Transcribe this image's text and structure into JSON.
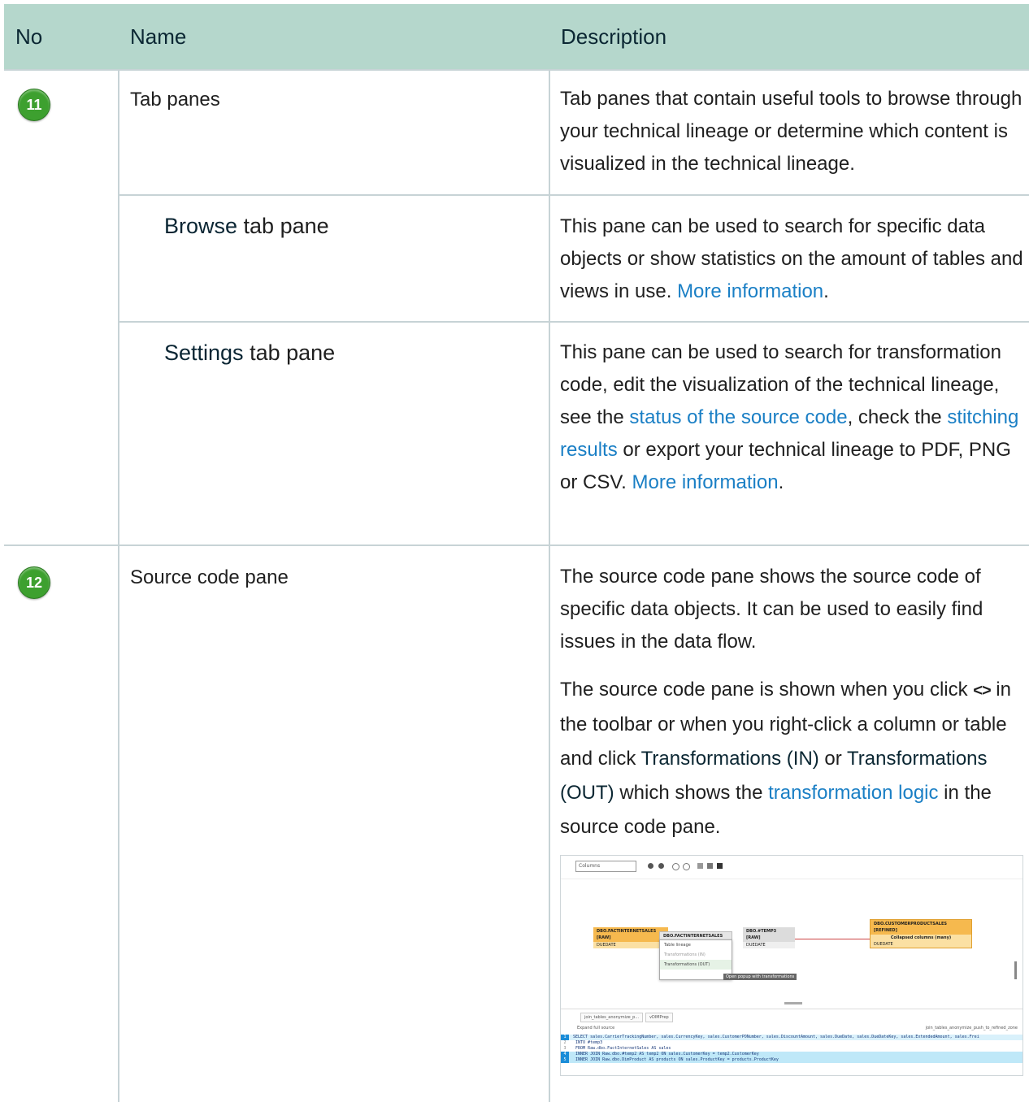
{
  "header": {
    "col_no": "No",
    "col_name": "Name",
    "col_description": "Description"
  },
  "rows": {
    "tab_panes": {
      "number": "11",
      "name": "Tab panes",
      "description": "Tab panes that contain useful tools to browse through your technical lineage or determine which content is visualized in the technical lineage."
    },
    "browse": {
      "name_bold": "Browse",
      "name_rest": " tab pane",
      "desc_text": "This pane can be used to search for specific data objects or show statistics on the amount of tables and views in use. ",
      "desc_link": "More information",
      "desc_end": "."
    },
    "settings": {
      "name_bold": "Settings",
      "name_rest": " tab pane",
      "desc_1": "This pane can be used to search for transformation code, edit the visualization of the technical lineage, see the ",
      "link_status": "status of the source code",
      "desc_2": ", check the ",
      "link_stitching": "stitching results",
      "desc_3": " or export your technical lineage to PDF, PNG or CSV. ",
      "link_more": "More information",
      "desc_end": "."
    },
    "source_code": {
      "number": "12",
      "name": "Source code pane",
      "para1": "The source code pane shows the source code of specific data objects. It can be used to easily find issues in the data flow.",
      "p2_a": "The source code pane is shown when you click ",
      "p2_icon": "<>",
      "p2_b": " in the toolbar or when you right-click a column or table and click ",
      "p2_kw1": "Transformations (IN)",
      "p2_c": " or ",
      "p2_kw2": "Transformations (OUT)",
      "p2_d": " which shows the ",
      "p2_link": "transformation logic",
      "p2_e": " in the source code pane."
    }
  },
  "screenshot": {
    "select_value": "Columns",
    "node1_title": "DBO.FACTINTERNETSALES [RAW]",
    "node1_field": "DUEDATE",
    "node2_title": "DBO.FACTINTERNETSALES [RAW]",
    "node3_title": "DBO.#TEMP3 [RAW]",
    "node3_field": "DUEDATE",
    "node4_title": "DBO.CUSTOMERPRODUCTSALES [REFINED]",
    "node4_sub": "Collapsed columns (many)",
    "node4_field": "DUEDATE",
    "menu_items": [
      "Table lineage",
      "Transformations (IN)",
      "Transformations (OUT)"
    ],
    "tooltip": "Open popup with transformations",
    "tab1": "join_tables_anonymize_p...",
    "tab2": "vDIMPrep",
    "expand_label": "Expand full source",
    "right_label": "join_tables_anonymize_push_to_refined_zone",
    "code_lines": [
      "SELECT sales.CarrierTrackingNumber, sales.CurrencyKey, sales.CustomerPONumber, sales.DiscountAmount, sales.DueDate, sales.DueDateKey, sales.ExtendedAmount, sales.Frei",
      "  INTO #temp3",
      "  FROM Raw.dbo.FactInternetSales AS sales",
      "  INNER JOIN Raw.dbo.#temp2 AS temp2 ON sales.CustomerKey = temp2.CustomerKey",
      "  INNER JOIN Raw.dbo.DimProduct AS products ON sales.ProductKey = products.ProductKey"
    ],
    "code_numbers": [
      "1",
      "2",
      "3",
      "4",
      "5"
    ]
  },
  "colors": {
    "header_bg": "#b5d7cc",
    "badge_green": "#3da02f",
    "link_blue": "#1a7fc5",
    "grid_line": "#c7d3d6"
  }
}
